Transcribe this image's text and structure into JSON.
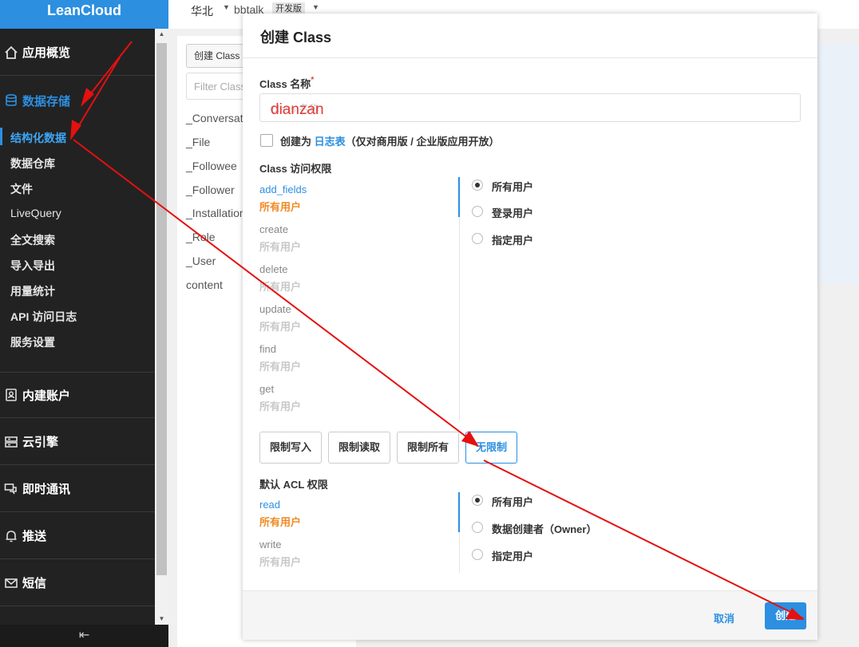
{
  "brand": "LeanCloud",
  "topbar": {
    "region": "华北",
    "app_name": "bbtalk",
    "badge": "开发版"
  },
  "sidebar": {
    "sections": [
      {
        "label": "应用概览",
        "icon": "home-icon"
      },
      {
        "label": "数据存储",
        "icon": "database-icon"
      },
      {
        "label": "内建账户",
        "icon": "user-card-icon"
      },
      {
        "label": "云引擎",
        "icon": "server-icon"
      },
      {
        "label": "即时通讯",
        "icon": "chat-icon"
      },
      {
        "label": "推送",
        "icon": "bell-icon"
      },
      {
        "label": "短信",
        "icon": "mail-icon"
      }
    ],
    "sub_items": [
      "结构化数据",
      "数据仓库",
      "文件",
      "LiveQuery",
      "全文搜索",
      "导入导出",
      "用量统计",
      "API 访问日志",
      "服务设置"
    ]
  },
  "classlist": {
    "create_button": "创建 Class",
    "filter_placeholder": "Filter Class",
    "classes": [
      "_Conversation",
      "_File",
      "_Followee",
      "_Follower",
      "_Installation",
      "_Role",
      "_User",
      "content"
    ]
  },
  "modal": {
    "title": "创建 Class",
    "name_label": "Class 名称",
    "required_mark": "*",
    "name_placeholder": "Class 名称",
    "name_value": "dianzan",
    "log_table": {
      "prefix": "创建为",
      "link": "日志表",
      "suffix": "（仅对商用版 / 企业版应用开放）"
    },
    "class_acl_label": "Class 访问权限",
    "class_permissions": [
      {
        "op": "add_fields",
        "who": "所有用户"
      },
      {
        "op": "create",
        "who": "所有用户"
      },
      {
        "op": "delete",
        "who": "所有用户"
      },
      {
        "op": "update",
        "who": "所有用户"
      },
      {
        "op": "find",
        "who": "所有用户"
      },
      {
        "op": "get",
        "who": "所有用户"
      }
    ],
    "class_radio_options": [
      "所有用户",
      "登录用户",
      "指定用户"
    ],
    "presets": [
      "限制写入",
      "限制读取",
      "限制所有",
      "无限制"
    ],
    "default_acl_label": "默认 ACL 权限",
    "default_permissions": [
      {
        "op": "read",
        "who": "所有用户"
      },
      {
        "op": "write",
        "who": "所有用户"
      }
    ],
    "default_radio_options": [
      "所有用户",
      "数据创建者（Owner）",
      "指定用户"
    ],
    "cancel": "取消",
    "create": "创建"
  },
  "colors": {
    "accent": "#2c8fe0",
    "selected_who": "#f08a24",
    "annotation_arrow": "#e51010"
  }
}
